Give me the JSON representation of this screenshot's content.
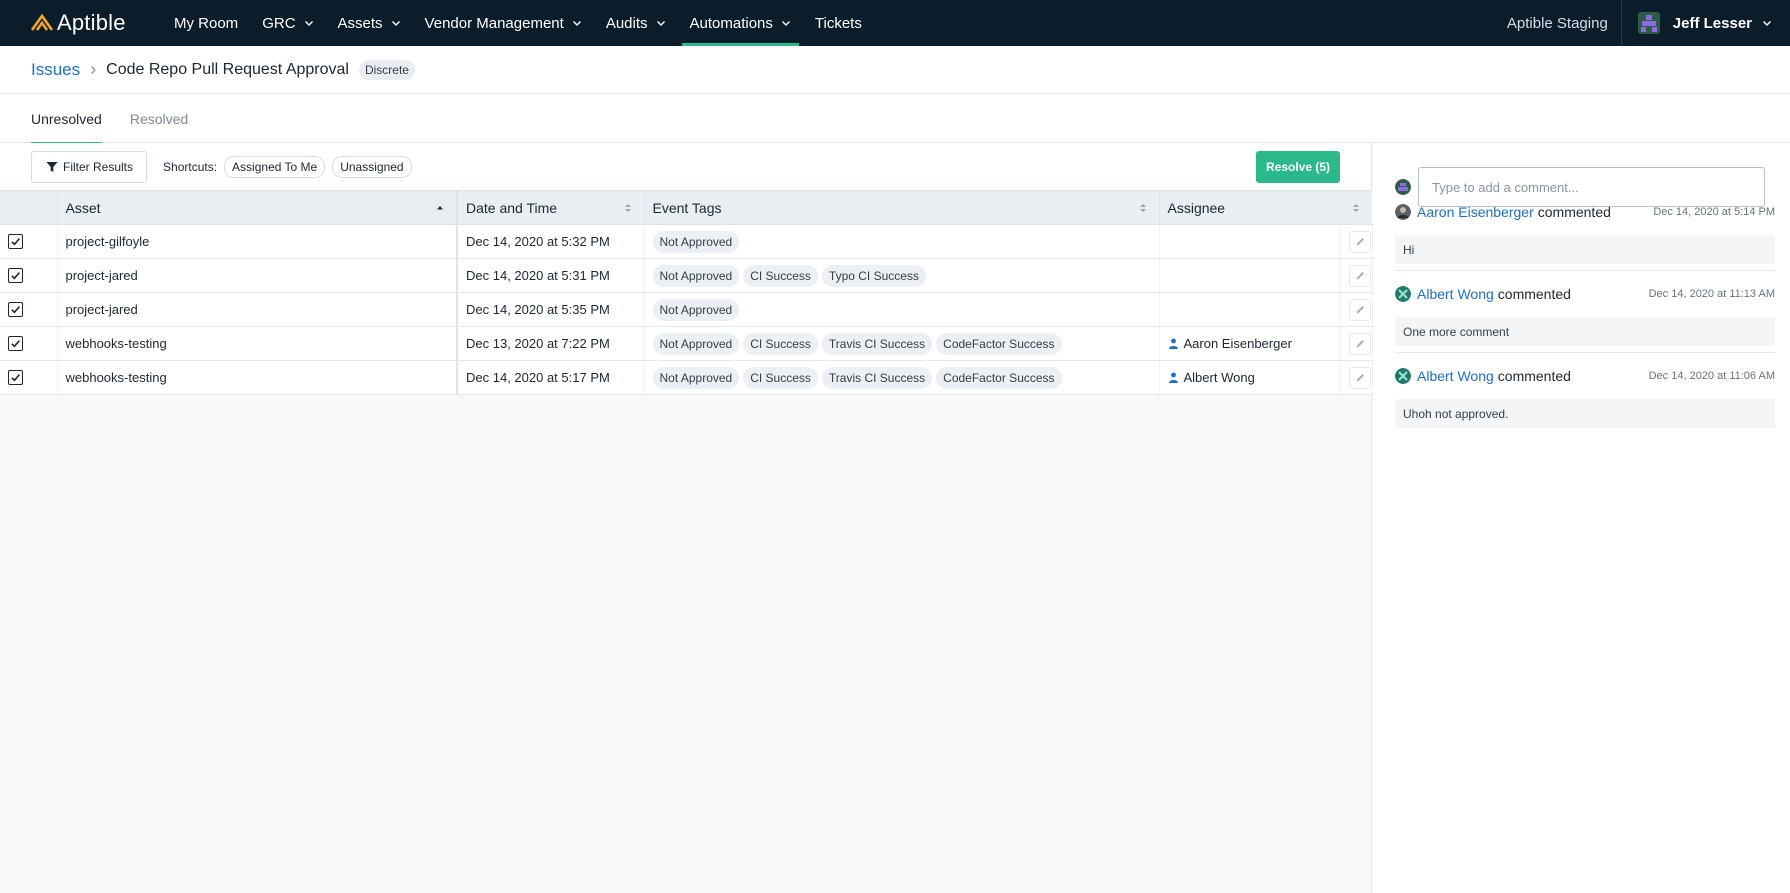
{
  "nav": {
    "brand": "Aptible",
    "items": [
      {
        "label": "My Room",
        "has_menu": false,
        "active": false
      },
      {
        "label": "GRC",
        "has_menu": true,
        "active": false
      },
      {
        "label": "Assets",
        "has_menu": true,
        "active": false
      },
      {
        "label": "Vendor Management",
        "has_menu": true,
        "active": false
      },
      {
        "label": "Audits",
        "has_menu": true,
        "active": false
      },
      {
        "label": "Automations",
        "has_menu": true,
        "active": true
      },
      {
        "label": "Tickets",
        "has_menu": false,
        "active": false
      }
    ],
    "org": "Aptible Staging",
    "user": "Jeff Lesser"
  },
  "breadcrumb": {
    "root": "Issues",
    "title": "Code Repo Pull Request Approval",
    "badge": "Discrete"
  },
  "tabs": [
    {
      "label": "Unresolved",
      "active": true
    },
    {
      "label": "Resolved",
      "active": false
    }
  ],
  "toolbar": {
    "filter_label": "Filter Results",
    "shortcuts_label": "Shortcuts:",
    "shortcuts": [
      "Assigned To Me",
      "Unassigned"
    ],
    "resolve_label": "Resolve (5)"
  },
  "table": {
    "columns": [
      "Asset",
      "Date and Time",
      "Event Tags",
      "Assignee"
    ],
    "rows": [
      {
        "checked": true,
        "asset": "project-gilfoyle",
        "datetime": "Dec 14, 2020 at 5:32 PM",
        "tags": [
          "Not Approved"
        ],
        "assignee": ""
      },
      {
        "checked": true,
        "asset": "project-jared",
        "datetime": "Dec 14, 2020 at 5:31 PM",
        "tags": [
          "Not Approved",
          "CI Success",
          "Typo CI Success"
        ],
        "assignee": ""
      },
      {
        "checked": true,
        "asset": "project-jared",
        "datetime": "Dec 14, 2020 at 5:35 PM",
        "tags": [
          "Not Approved"
        ],
        "assignee": ""
      },
      {
        "checked": true,
        "asset": "webhooks-testing",
        "datetime": "Dec 13, 2020 at 7:22 PM",
        "tags": [
          "Not Approved",
          "CI Success",
          "Travis CI Success",
          "CodeFactor Success"
        ],
        "assignee": "Aaron Eisenberger"
      },
      {
        "checked": true,
        "asset": "webhooks-testing",
        "datetime": "Dec 14, 2020 at 5:17 PM",
        "tags": [
          "Not Approved",
          "CI Success",
          "Travis CI Success",
          "CodeFactor Success"
        ],
        "assignee": "Albert Wong"
      }
    ]
  },
  "comments_panel": {
    "placeholder": "Type to add a comment...",
    "comments": [
      {
        "author": "Aaron Eisenberger",
        "verb": "commented",
        "date": "Dec 14, 2020 at 5:14 PM",
        "body": "Hi"
      },
      {
        "author": "Albert Wong",
        "verb": "commented",
        "date": "Dec 14, 2020 at 11:13 AM",
        "body": "One more comment"
      },
      {
        "author": "Albert Wong",
        "verb": "commented",
        "date": "Dec 14, 2020 at 11:06 AM",
        "body": "Uhoh not approved."
      }
    ]
  },
  "colors": {
    "nav_bg": "#0b1d2a",
    "accent": "#2bb88a",
    "link": "#1f6fc5"
  }
}
